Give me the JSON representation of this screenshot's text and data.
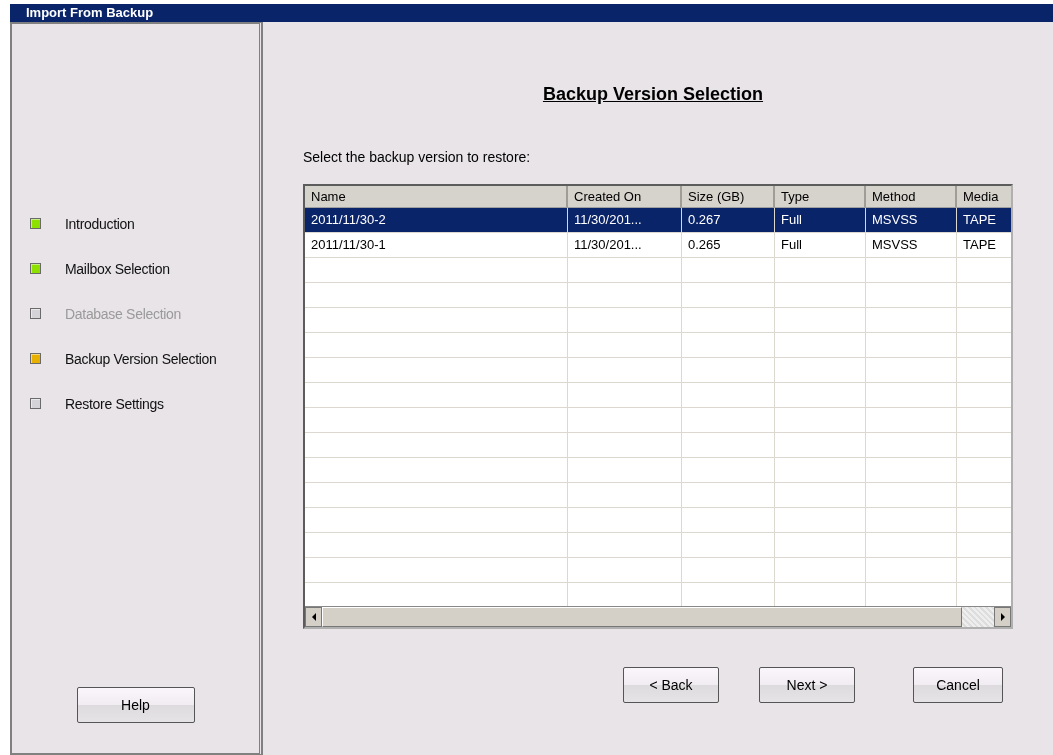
{
  "window": {
    "title": "Import From Backup"
  },
  "steps": [
    {
      "label": "Introduction",
      "kind": "done"
    },
    {
      "label": "Mailbox Selection",
      "kind": "done"
    },
    {
      "label": "Database Selection",
      "kind": "skipped"
    },
    {
      "label": "Backup Version Selection",
      "kind": "current"
    },
    {
      "label": "Restore Settings",
      "kind": "pending"
    }
  ],
  "help_button": "Help",
  "page_title": "Backup Version Selection",
  "prompt": "Select the backup version to restore:",
  "table": {
    "columns": [
      "Name",
      "Created On",
      "Size (GB)",
      "Type",
      "Method",
      "Media"
    ],
    "rows": [
      {
        "cells": [
          "2011/11/30-2",
          "11/30/201...",
          "0.267",
          "Full",
          "MSVSS",
          "TAPE"
        ],
        "selected": true
      },
      {
        "cells": [
          "2011/11/30-1",
          "11/30/201...",
          "0.265",
          "Full",
          "MSVSS",
          "TAPE"
        ],
        "selected": false
      }
    ]
  },
  "buttons": [
    "< Back",
    "Next >",
    "Cancel"
  ]
}
